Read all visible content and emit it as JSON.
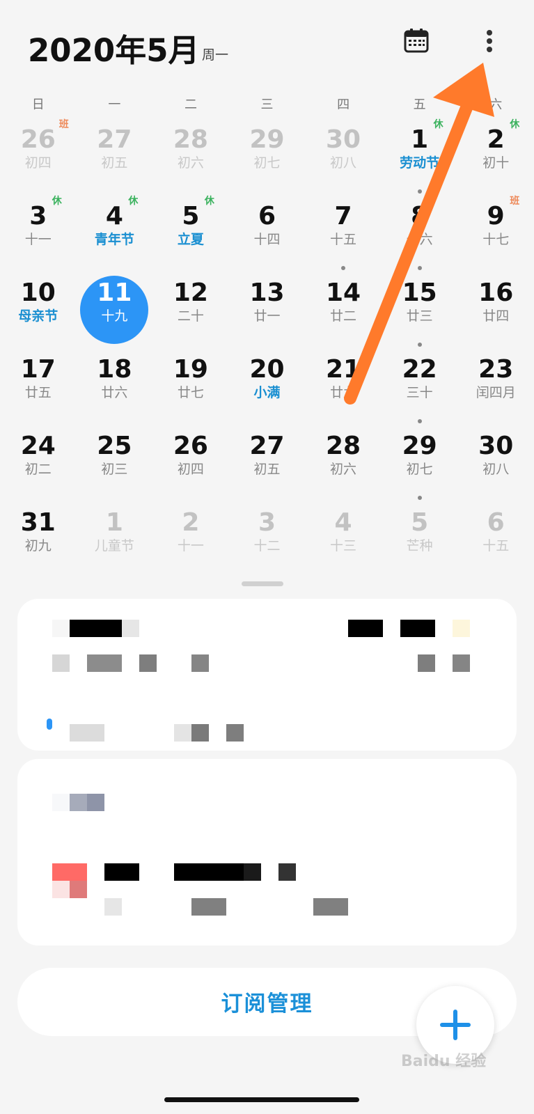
{
  "header": {
    "title": "2020年5月",
    "weekday": "周一",
    "calendar_icon": "calendar-icon",
    "more_icon": "more-vertical-icon"
  },
  "weekdays": [
    "日",
    "一",
    "二",
    "三",
    "四",
    "五",
    "六"
  ],
  "days": [
    {
      "num": "26",
      "sub": "初四",
      "badge": "班",
      "badge_type": "work",
      "muted": true
    },
    {
      "num": "27",
      "sub": "初五",
      "muted": true
    },
    {
      "num": "28",
      "sub": "初六",
      "muted": true
    },
    {
      "num": "29",
      "sub": "初七",
      "muted": true
    },
    {
      "num": "30",
      "sub": "初八",
      "muted": true
    },
    {
      "num": "1",
      "sub": "劳动节",
      "fest": true,
      "badge": "休",
      "badge_type": "rest"
    },
    {
      "num": "2",
      "sub": "初十",
      "badge": "休",
      "badge_type": "rest"
    },
    {
      "num": "3",
      "sub": "十一",
      "badge": "休",
      "badge_type": "rest"
    },
    {
      "num": "4",
      "sub": "青年节",
      "fest": true,
      "badge": "休",
      "badge_type": "rest"
    },
    {
      "num": "5",
      "sub": "立夏",
      "fest": true,
      "badge": "休",
      "badge_type": "rest"
    },
    {
      "num": "6",
      "sub": "十四"
    },
    {
      "num": "7",
      "sub": "十五"
    },
    {
      "num": "8",
      "sub": "十六",
      "dot": true
    },
    {
      "num": "9",
      "sub": "十七",
      "badge": "班",
      "badge_type": "work"
    },
    {
      "num": "10",
      "sub": "母亲节",
      "fest": true
    },
    {
      "num": "11",
      "sub": "十九",
      "selected": true
    },
    {
      "num": "12",
      "sub": "二十"
    },
    {
      "num": "13",
      "sub": "廿一"
    },
    {
      "num": "14",
      "sub": "廿二",
      "dot": true
    },
    {
      "num": "15",
      "sub": "廿三",
      "dot": true
    },
    {
      "num": "16",
      "sub": "廿四"
    },
    {
      "num": "17",
      "sub": "廿五"
    },
    {
      "num": "18",
      "sub": "廿六"
    },
    {
      "num": "19",
      "sub": "廿七"
    },
    {
      "num": "20",
      "sub": "小满",
      "fest": true
    },
    {
      "num": "21",
      "sub": "廿九"
    },
    {
      "num": "22",
      "sub": "三十",
      "dot": true
    },
    {
      "num": "23",
      "sub": "闰四月"
    },
    {
      "num": "24",
      "sub": "初二"
    },
    {
      "num": "25",
      "sub": "初三"
    },
    {
      "num": "26",
      "sub": "初四"
    },
    {
      "num": "27",
      "sub": "初五"
    },
    {
      "num": "28",
      "sub": "初六"
    },
    {
      "num": "29",
      "sub": "初七",
      "dot": true
    },
    {
      "num": "30",
      "sub": "初八"
    },
    {
      "num": "31",
      "sub": "初九"
    },
    {
      "num": "1",
      "sub": "儿童节",
      "muted": true
    },
    {
      "num": "2",
      "sub": "十一",
      "muted": true
    },
    {
      "num": "3",
      "sub": "十二",
      "muted": true
    },
    {
      "num": "4",
      "sub": "十三",
      "muted": true
    },
    {
      "num": "5",
      "sub": "芒种",
      "muted": true,
      "dot": true
    },
    {
      "num": "6",
      "sub": "十五",
      "muted": true
    }
  ],
  "subscribe_label": "订阅管理",
  "fab_icon": "plus-icon",
  "watermark": "Baidu 经验",
  "colors": {
    "accent": "#2c95f6",
    "festival": "#1a8fd1",
    "rest_badge": "#3bb25e",
    "work_badge": "#ee8a5a",
    "arrow": "#ff7a2b"
  }
}
